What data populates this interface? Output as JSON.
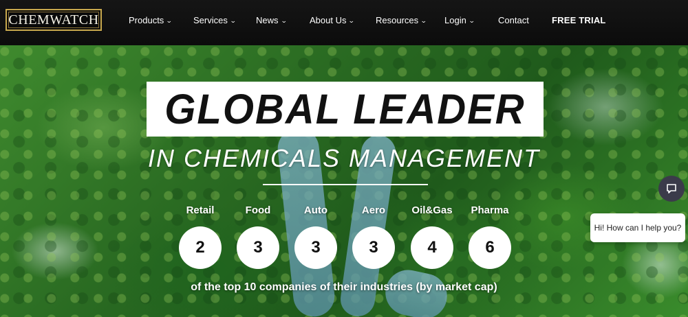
{
  "header": {
    "logo_text": "CHEMWATCH",
    "nav": [
      {
        "label": "Products",
        "has_dropdown": true
      },
      {
        "label": "Services",
        "has_dropdown": true
      },
      {
        "label": "News",
        "has_dropdown": true
      },
      {
        "label": "About Us",
        "has_dropdown": true
      },
      {
        "label": "Resources",
        "has_dropdown": true
      },
      {
        "label": "Login",
        "has_dropdown": true
      },
      {
        "label": "Contact",
        "has_dropdown": false
      },
      {
        "label": "FREE TRIAL",
        "has_dropdown": false
      }
    ],
    "dropdown_glyph": "⌄"
  },
  "hero": {
    "title": "GLOBAL LEADER",
    "subtitle": "IN CHEMICALS MANAGEMENT",
    "stats": [
      {
        "label": "Retail",
        "value": "2"
      },
      {
        "label": "Food",
        "value": "3"
      },
      {
        "label": "Auto",
        "value": "3"
      },
      {
        "label": "Aero",
        "value": "3"
      },
      {
        "label": "Oil&Gas",
        "value": "4"
      },
      {
        "label": "Pharma",
        "value": "6"
      }
    ],
    "caption": "of the top 10 companies of their industries (by market cap)"
  },
  "chat": {
    "icon": "chat-icon",
    "bubble_text": "Hi! How can I help you?"
  },
  "colors": {
    "header_bg": "#0c0c0c",
    "logo_border": "#c9a94e",
    "chat_button": "#3b3b4a",
    "forest": "#2a6b22"
  }
}
